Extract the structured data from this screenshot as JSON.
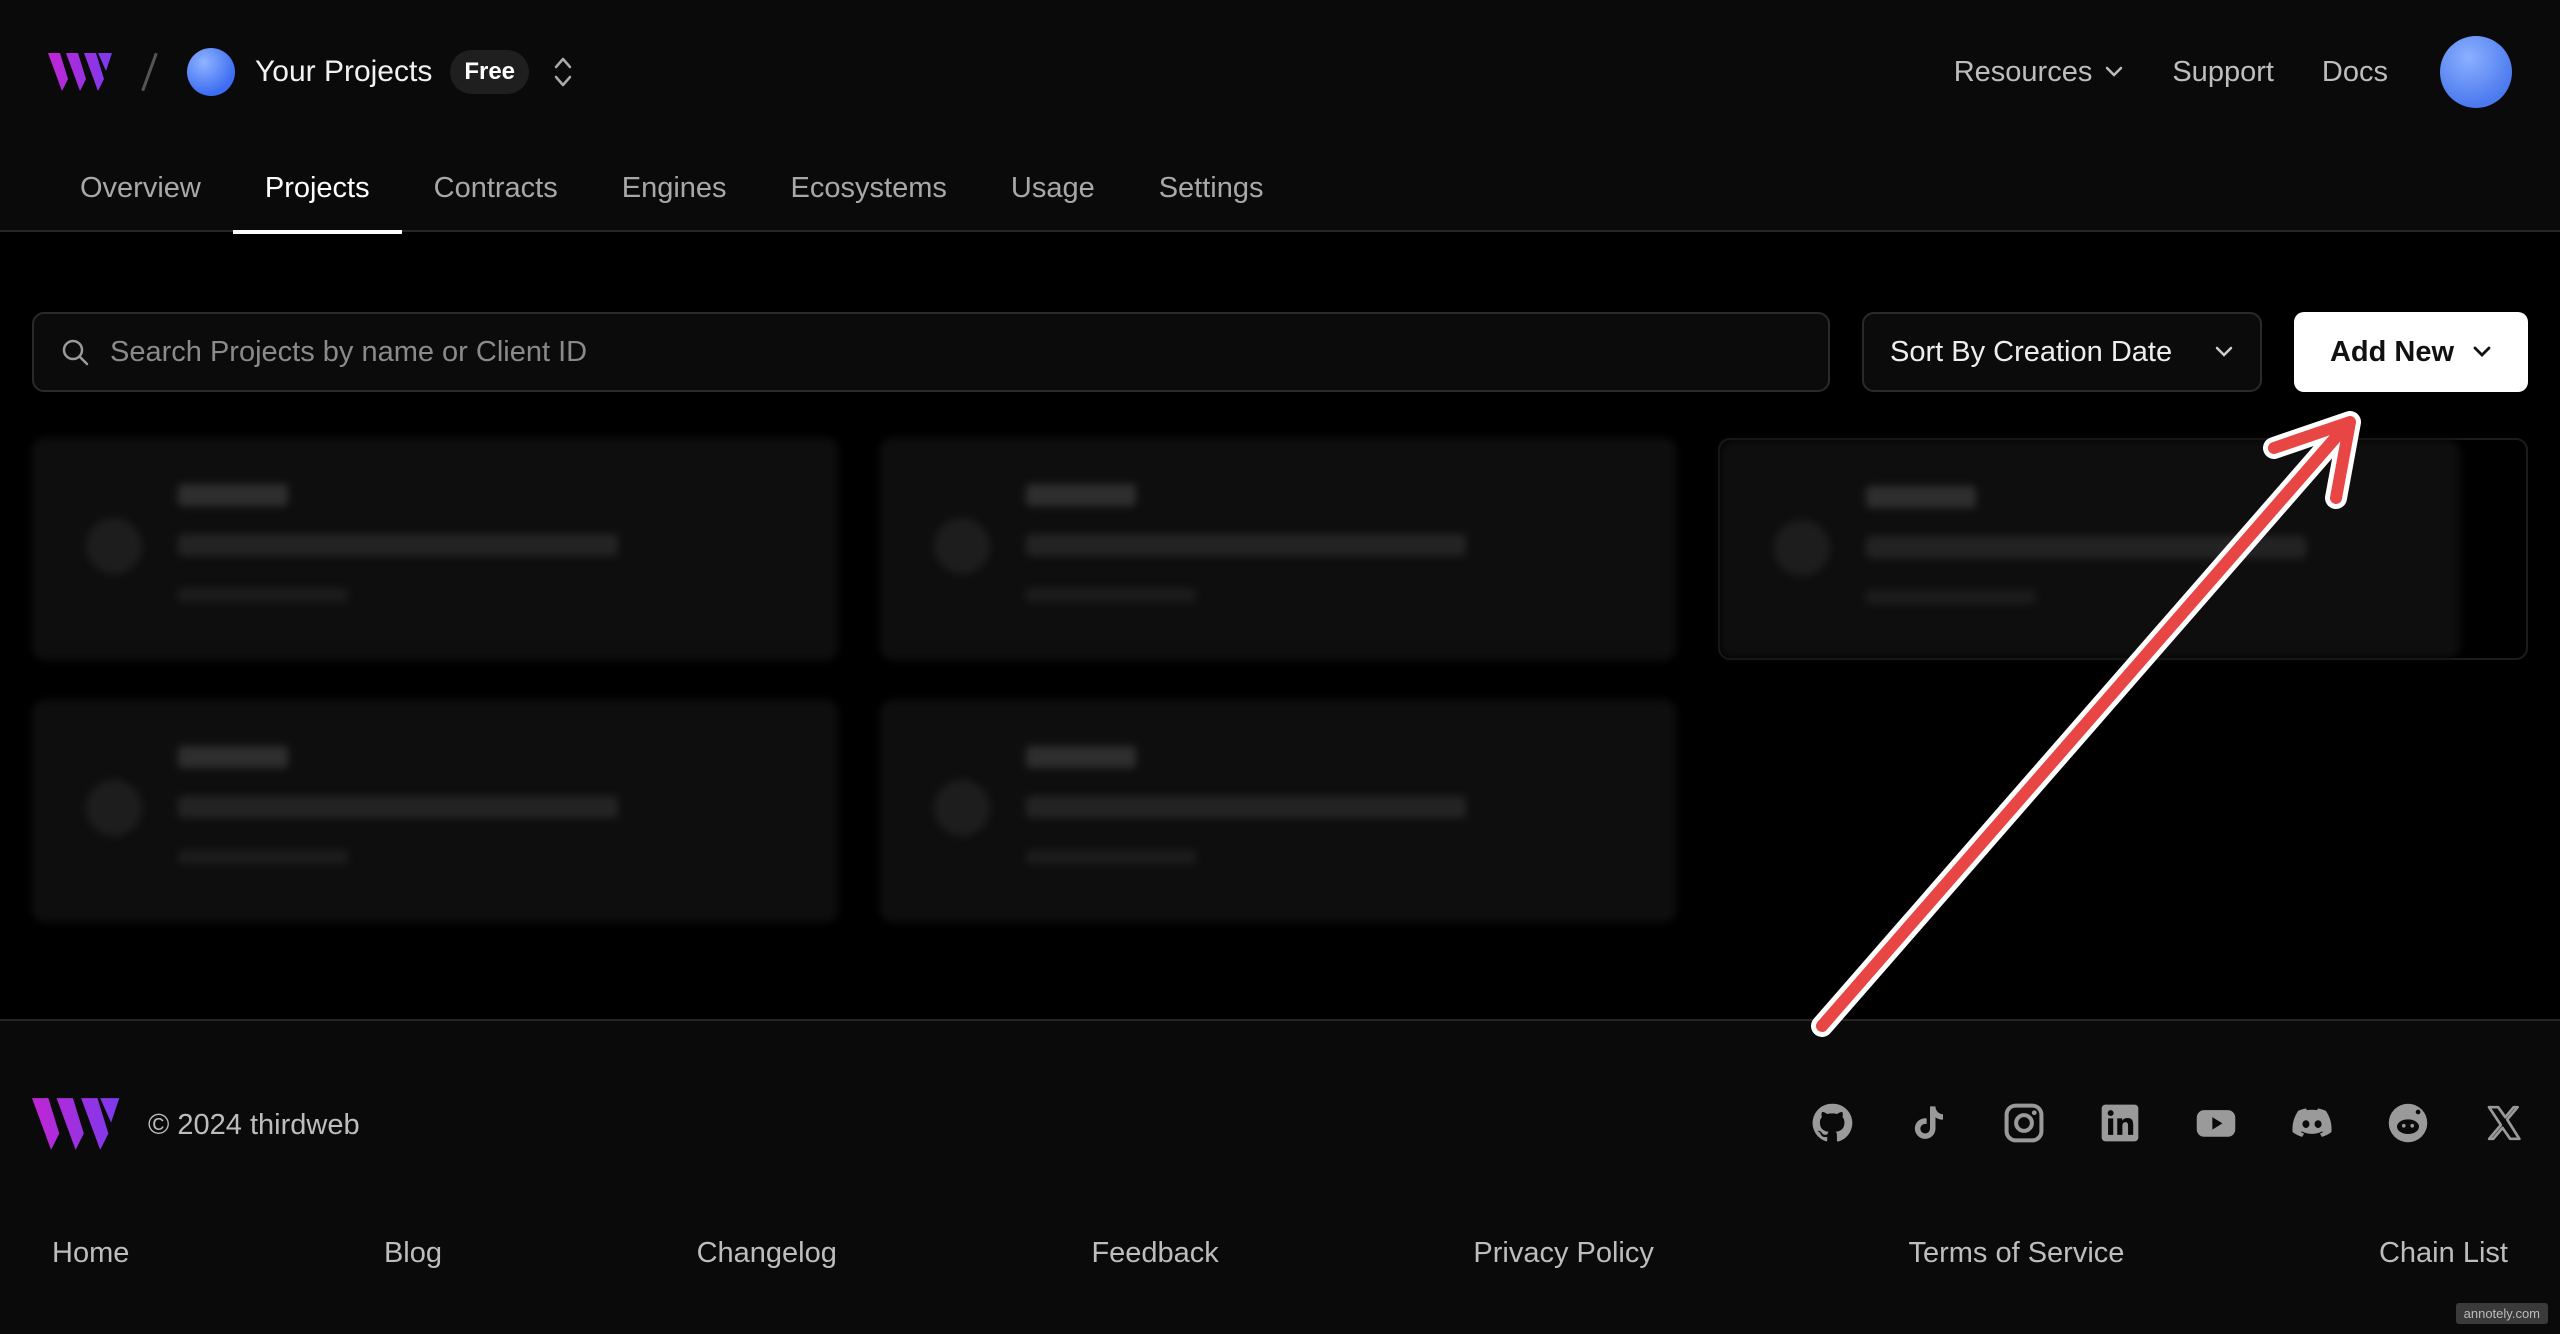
{
  "header": {
    "project_title": "Your Projects",
    "plan_badge": "Free",
    "nav_links": [
      "Resources",
      "Support",
      "Docs"
    ]
  },
  "tabs": [
    {
      "label": "Overview",
      "active": false
    },
    {
      "label": "Projects",
      "active": true
    },
    {
      "label": "Contracts",
      "active": false
    },
    {
      "label": "Engines",
      "active": false
    },
    {
      "label": "Ecosystems",
      "active": false
    },
    {
      "label": "Usage",
      "active": false
    },
    {
      "label": "Settings",
      "active": false
    }
  ],
  "toolbar": {
    "search_placeholder": "Search Projects by name or Client ID",
    "sort_label": "Sort By Creation Date",
    "add_new_label": "Add New"
  },
  "footer": {
    "copyright": "© 2024 thirdweb",
    "social_icons": [
      "github-icon",
      "tiktok-icon",
      "instagram-icon",
      "linkedin-icon",
      "youtube-icon",
      "discord-icon",
      "reddit-icon",
      "x-icon"
    ],
    "links": [
      "Home",
      "Blog",
      "Changelog",
      "Feedback",
      "Privacy Policy",
      "Terms of Service",
      "Chain List"
    ]
  },
  "watermark": "annotely.com",
  "colors": {
    "background": "#000000",
    "brand_gradient_start": "#c026d3",
    "brand_gradient_end": "#7c3aed",
    "annotation_arrow": "#e84545"
  }
}
